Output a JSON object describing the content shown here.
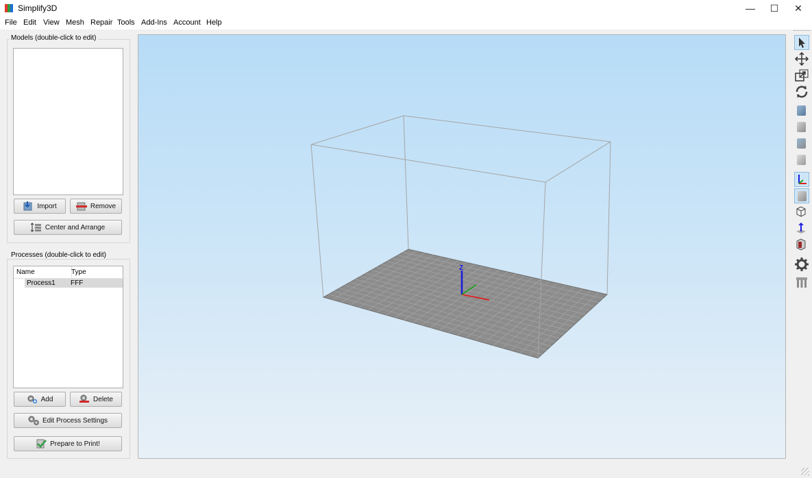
{
  "window": {
    "title": "Simplify3D",
    "minimize": "—",
    "maximize": "☐",
    "close": "✕"
  },
  "menu": [
    "File",
    "Edit",
    "View",
    "Mesh",
    "Repair",
    "Tools",
    "Add-Ins",
    "Account",
    "Help"
  ],
  "models": {
    "title": "Models (double-click to edit)",
    "import_label": "Import",
    "remove_label": "Remove",
    "center_label": "Center and Arrange"
  },
  "processes": {
    "title": "Processes (double-click to edit)",
    "columns": [
      "Name",
      "Type"
    ],
    "rows": [
      {
        "name": "Process1",
        "type": "FFF"
      }
    ],
    "add_label": "Add",
    "delete_label": "Delete",
    "edit_label": "Edit Process Settings",
    "prepare_label": "Prepare to Print!"
  },
  "viewport": {
    "axis_label": "Z"
  },
  "colors": {
    "accent": "#0078d7",
    "axis_x": "#e02020",
    "axis_y": "#20a020",
    "axis_z": "#1a1ae0",
    "bed": "#8c8c8c"
  }
}
